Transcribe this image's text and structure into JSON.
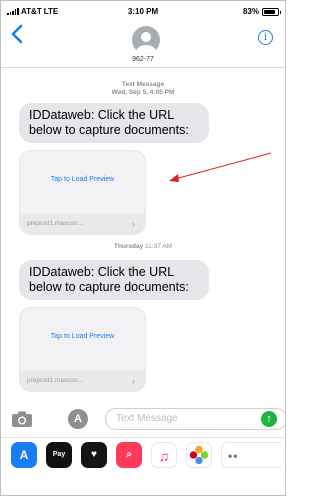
{
  "status_bar": {
    "carrier": "AT&T",
    "network": "LTE",
    "time": "3:10 PM",
    "battery": "83%",
    "battery_level": 0.83
  },
  "header": {
    "contact_name": "962-77",
    "back_icon": "chevron-left-icon",
    "info_icon": "info-icon"
  },
  "messages": [
    {
      "stamp_label": "Text Message",
      "stamp_time": "Wed, Sep 5, 4:05 PM",
      "text": "IDDataweb: Click the URL below to capture documents:",
      "preview_action": "Tap to Load Preview",
      "preview_domain": "preprod1.maxcon..."
    },
    {
      "stamp_label": "Thursday",
      "stamp_time": "11:37 AM",
      "text": "IDDataweb: Click the URL below to capture documents:",
      "preview_action": "Tap to Load Preview",
      "preview_domain": "preprod1.maxcon..."
    }
  ],
  "compose": {
    "placeholder": "Text Message"
  },
  "app_drawer": {
    "apps": [
      "A",
      "Pay",
      "♥",
      "⌕",
      "♫",
      "",
      "••"
    ]
  },
  "annotation": {
    "arrow_color": "#e0201b"
  }
}
